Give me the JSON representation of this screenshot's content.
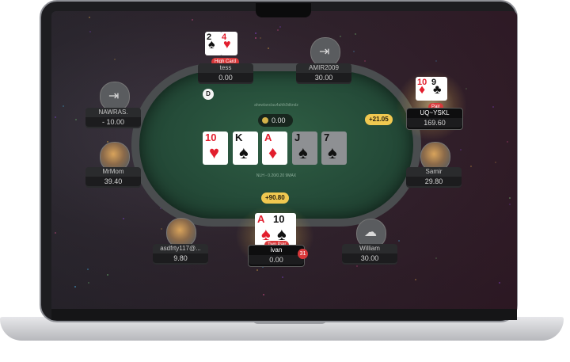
{
  "table": {
    "hand_id": "ahewlanclau4ahlk9dkndz",
    "game_label": "NLH - 0.20/0.20 9MAX",
    "pot": "0.00",
    "dealer_label": "D",
    "bet_right": "+21.05",
    "bet_bottom": "+90.80",
    "board": [
      {
        "rank": "10",
        "suit": "♥",
        "color": "red",
        "dim": false
      },
      {
        "rank": "K",
        "suit": "♠",
        "color": "black",
        "dim": false
      },
      {
        "rank": "A",
        "suit": "♦",
        "color": "red",
        "dim": false
      },
      {
        "rank": "J",
        "suit": "♠",
        "color": "black",
        "dim": true
      },
      {
        "rank": "7",
        "suit": "♠",
        "color": "black",
        "dim": true
      }
    ]
  },
  "players": {
    "tess": {
      "name": "tess",
      "stack": "0.00",
      "badge": "High Card",
      "cards": [
        {
          "rank": "2",
          "suit": "♠"
        },
        {
          "rank": "4",
          "suit": "♥"
        }
      ]
    },
    "amir": {
      "name": "AMIR2009",
      "stack": "30.00",
      "icon": "exit-icon"
    },
    "nawras": {
      "name": "NAWRAS.",
      "stack": "- 10.00",
      "icon": "exit-icon"
    },
    "uq": {
      "name": "UQ~YSKL",
      "stack": "169.60",
      "badge": "Pair",
      "cards": [
        {
          "rank": "10",
          "suit": "♦"
        },
        {
          "rank": "9",
          "suit": "♣"
        }
      ]
    },
    "mrmom": {
      "name": "MrMom",
      "stack": "39.40"
    },
    "samir": {
      "name": "Samir",
      "stack": "29.80"
    },
    "asd": {
      "name": "asdfrty117@...",
      "stack": "9.80"
    },
    "ivan": {
      "name": "ivan",
      "stack": "0.00",
      "badge": "Two Pair",
      "timer": "31",
      "cards": [
        {
          "rank": "A",
          "suit": "♠"
        },
        {
          "rank": "10",
          "suit": "♠"
        }
      ]
    },
    "william": {
      "name": "William",
      "stack": "30.00",
      "icon": "cloud-offline-icon"
    }
  },
  "colors": {
    "felt": "#2a5640",
    "bet_pill": "#f0c850",
    "badge": "#d8383a"
  }
}
